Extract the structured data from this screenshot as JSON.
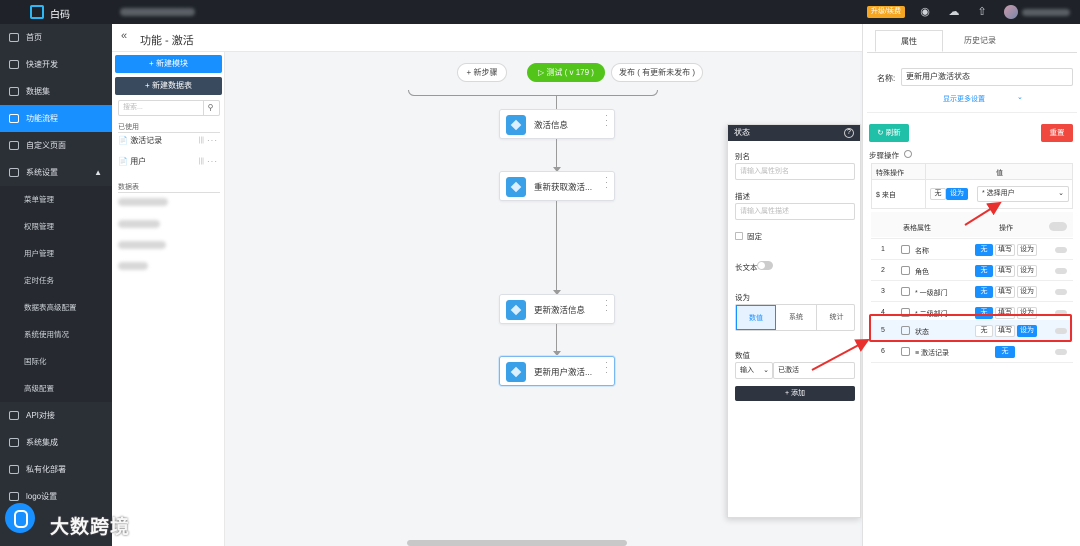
{
  "topbar": {
    "brand": "白码",
    "upgrade": "升级/续费"
  },
  "sidebar": {
    "items": [
      {
        "label": "首页"
      },
      {
        "label": "快速开发"
      },
      {
        "label": "数据集"
      },
      {
        "label": "功能流程"
      },
      {
        "label": "自定义页面"
      },
      {
        "label": "系统设置"
      },
      {
        "label": "API对接"
      },
      {
        "label": "系统集成"
      },
      {
        "label": "私有化部署"
      },
      {
        "label": "logo设置"
      }
    ],
    "subitems": [
      {
        "label": "菜单管理"
      },
      {
        "label": "权限管理"
      },
      {
        "label": "用户管理"
      },
      {
        "label": "定时任务"
      },
      {
        "label": "数据表高级配置"
      },
      {
        "label": "系统使用情况"
      },
      {
        "label": "国际化"
      },
      {
        "label": "高级配置"
      }
    ]
  },
  "header": {
    "back": "«",
    "title": "功能 - 激活"
  },
  "left_panel": {
    "new_module": "+ 新建模块",
    "new_table": "+ 新建数据表",
    "search_placeholder": "搜索...",
    "used_label": "已使用",
    "used_items": [
      {
        "label": "激活记录"
      },
      {
        "label": "用户"
      }
    ],
    "tables_label": "数据表"
  },
  "toolbar": {
    "new_step": "+ 新步骤",
    "test": "▷ 测试 ( v 179 )",
    "publish": "发布 ( 有更新未发布 )"
  },
  "nodes": [
    {
      "label": "激活信息"
    },
    {
      "label": "重新获取激活..."
    },
    {
      "label": "更新激活信息"
    },
    {
      "label": "更新用户激活..."
    }
  ],
  "popup": {
    "title": "状态",
    "alias_label": "别名",
    "alias_placeholder": "请输入属性别名",
    "desc_label": "描述",
    "desc_placeholder": "请输入属性描述",
    "fixed_label": "固定",
    "longtext_label": "长文本",
    "setas_label": "设为",
    "seg": [
      "数值",
      "系统",
      "统计"
    ],
    "value_label": "数值",
    "input_mode": "输入",
    "value": "已激活",
    "add": "+ 添加"
  },
  "right_panel": {
    "tab_props": "属性",
    "tab_history": "历史记录",
    "name_label": "名称:",
    "name_value": "更新用户激活状态",
    "more": "显示更多设置",
    "refresh": "刷新",
    "reset": "重置",
    "step_ops": "步骤操作",
    "special_op": "特殊操作",
    "value_col": "值",
    "source_label": "$ 来自",
    "none": "无",
    "setas": "设为",
    "select_user": "* 选择用户",
    "table_props": "表格属性",
    "ops": "操作",
    "fill": "填写",
    "rows": [
      {
        "no": "1",
        "name": "名称"
      },
      {
        "no": "2",
        "name": "角色"
      },
      {
        "no": "3",
        "name": "* 一级部门"
      },
      {
        "no": "4",
        "name": "* 二级部门"
      },
      {
        "no": "5",
        "name": "状态"
      },
      {
        "no": "6",
        "name": "≡ 激活记录"
      }
    ]
  },
  "watermark": {
    "text": "大数跨境"
  }
}
